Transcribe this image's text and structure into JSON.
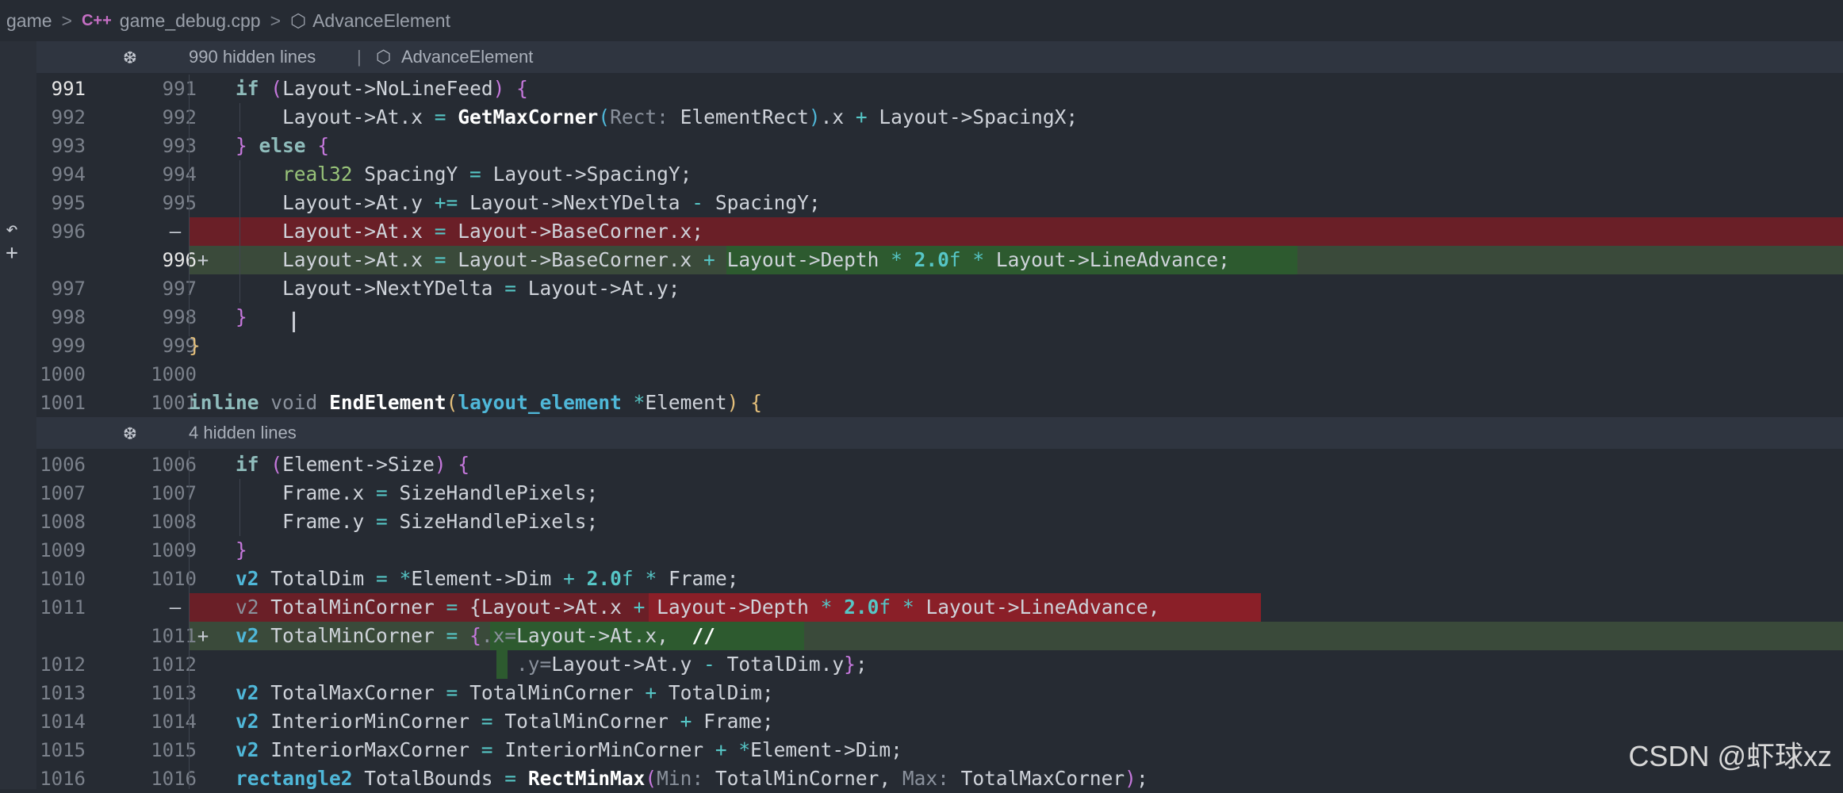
{
  "breadcrumb": {
    "items": [
      "game",
      "game_debug.cpp",
      "AdvanceElement"
    ],
    "cpp_icon": "C++",
    "symbol_icon": "cube-icon"
  },
  "folds": [
    {
      "label": "990 hidden lines",
      "symbol": "AdvanceElement"
    },
    {
      "label": "4 hidden lines"
    }
  ],
  "colors": {
    "background": "#262b33",
    "deleted_line": "#6a1f27",
    "added_line": "#3a4a3a",
    "keyword": "#c678dd",
    "type": "#4fb7d8"
  },
  "watermark": "CSDN @虾球xz"
}
